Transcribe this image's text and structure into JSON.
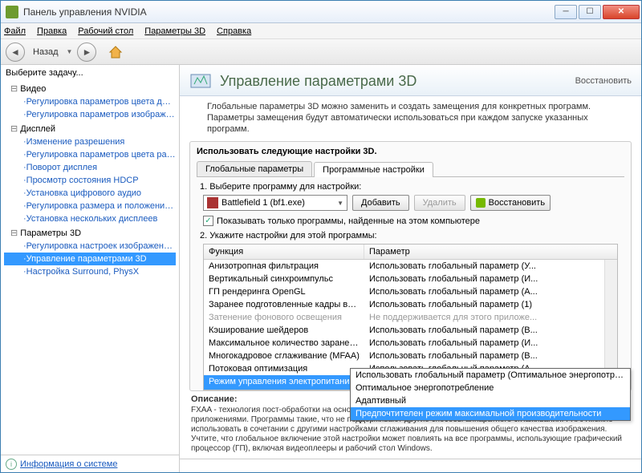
{
  "window": {
    "title": "Панель управления NVIDIA"
  },
  "menu": {
    "file": "Файл",
    "edit": "Правка",
    "desktop": "Рабочий стол",
    "params3d": "Параметры 3D",
    "help": "Справка"
  },
  "nav": {
    "back": "Назад"
  },
  "sidebar": {
    "header": "Выберите задачу...",
    "groups": [
      {
        "label": "Видео",
        "items": [
          "Регулировка параметров цвета для вид",
          "Регулировка параметров изображения д"
        ]
      },
      {
        "label": "Дисплей",
        "items": [
          "Изменение разрешения",
          "Регулировка параметров цвета рабочег",
          "Поворот дисплея",
          "Просмотр состояния HDCP",
          "Установка цифрового аудио",
          "Регулировка размера и положения рабо",
          "Установка нескольких дисплеев"
        ]
      },
      {
        "label": "Параметры 3D",
        "items": [
          "Регулировка настроек изображения с пр",
          "Управление параметрами 3D",
          "Настройка Surround, PhysX"
        ]
      }
    ],
    "selected": "Управление параметрами 3D"
  },
  "status": {
    "link": "Информация о системе"
  },
  "page": {
    "title": "Управление параметрами 3D",
    "restore": "Восстановить",
    "desc": "Глобальные параметры 3D можно заменить и создать замещения для конкретных программ. Параметры замещения будут автоматически использоваться при каждом запуске указанных программ."
  },
  "settings": {
    "caption": "Использовать следующие настройки 3D.",
    "tabs": [
      "Глобальные параметры",
      "Программные настройки"
    ],
    "active_tab": 1,
    "step1": "1. Выберите программу для настройки:",
    "program": "Battlefield 1 (bf1.exe)",
    "add": "Добавить",
    "remove": "Удалить",
    "restore_btn": "Восстановить",
    "checkbox": "Показывать только программы, найденные на этом компьютере",
    "step2": "2. Укажите настройки для этой программы:",
    "cols": {
      "func": "Функция",
      "param": "Параметр"
    },
    "rows": [
      {
        "f": "Анизотропная фильтрация",
        "p": "Использовать глобальный параметр (У...",
        "d": false
      },
      {
        "f": "Вертикальный синхроимпульс",
        "p": "Использовать глобальный параметр (И...",
        "d": false
      },
      {
        "f": "ГП рендеринга OpenGL",
        "p": "Использовать глобальный параметр (А...",
        "d": false
      },
      {
        "f": "Заранее подготовленные кадры вирту...",
        "p": "Использовать глобальный параметр (1)",
        "d": false
      },
      {
        "f": "Затенение фонового освещения",
        "p": "Не поддерживается для этого приложе...",
        "d": true
      },
      {
        "f": "Кэширование шейдеров",
        "p": "Использовать глобальный параметр (В...",
        "d": false
      },
      {
        "f": "Максимальное количество заранее под...",
        "p": "Использовать глобальный параметр (И...",
        "d": false
      },
      {
        "f": "Многокадровое сглаживание (MFAA)",
        "p": "Использовать глобальный параметр (В...",
        "d": false
      },
      {
        "f": "Потоковая оптимизация",
        "p": "Использовать глобальный параметр (А...",
        "d": false
      }
    ],
    "sel_row": {
      "f": "Режим управления электропитанием",
      "p": "Предпочтителен режим максимальной п"
    },
    "dropdown": [
      "Использовать глобальный параметр (Оптимальное энергопотребление)",
      "Оптимальное энергопотребление",
      "Адаптивный",
      "Предпочтителен режим максимальной производительности"
    ],
    "dropdown_hl": 3
  },
  "help": {
    "title": "Описание:",
    "body": "FXAA - технология пост-обработки на основе быстрого и качественного, хорошо совместимого с другими приложениями. Программы такие, что не поддерживают другие способы аппаратного сглаживания. FXAA можно использовать в сочетании с другими настройками сглаживания для повышения общего качества изображения. Учтите, что глобальное включение этой настройки может повлиять на все программы, использующие графический процессор (ГП), включая видеоплееры и рабочий стол Windows."
  }
}
